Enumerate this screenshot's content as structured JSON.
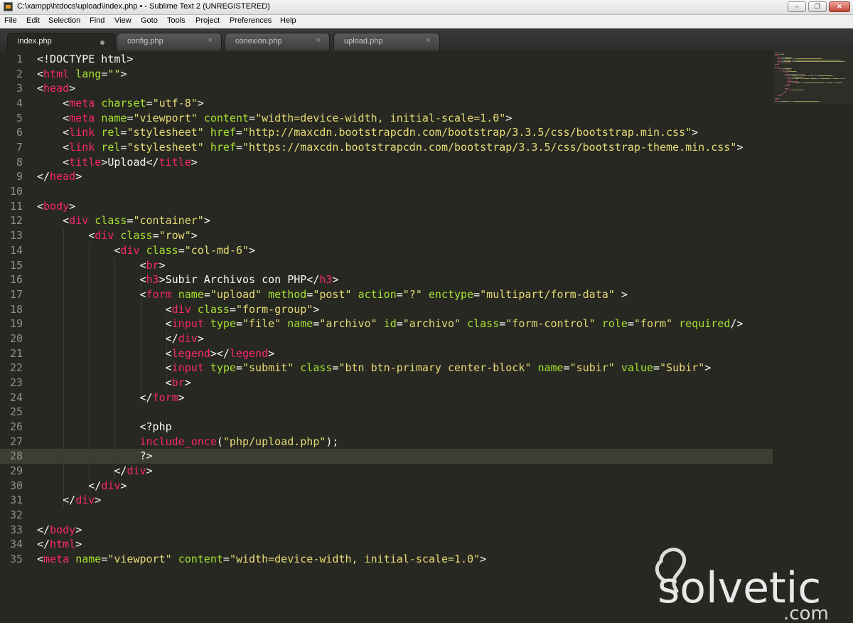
{
  "window": {
    "title": "C:\\xampp\\htdocs\\upload\\index.php • - Sublime Text 2 (UNREGISTERED)",
    "controls": {
      "minimize": "‒",
      "maximize": "❐",
      "close": "✕"
    }
  },
  "menu": [
    "File",
    "Edit",
    "Selection",
    "Find",
    "View",
    "Goto",
    "Tools",
    "Project",
    "Preferences",
    "Help"
  ],
  "tabs": [
    {
      "label": "index.php",
      "active": true,
      "dirty": true
    },
    {
      "label": "config.php",
      "active": false,
      "close": "×"
    },
    {
      "label": "conexion.php",
      "active": false,
      "close": "×"
    },
    {
      "label": "upload.php",
      "active": false,
      "close": "×"
    }
  ],
  "editor": {
    "current_line": 28,
    "theme_colors": {
      "background": "#272822",
      "tag": "#f92672",
      "attribute": "#a6e22e",
      "string": "#e6db74",
      "text": "#f8f8f2",
      "gutter": "#8f908a"
    },
    "lines": [
      [
        [
          "p",
          "<!DOCTYPE html>"
        ]
      ],
      [
        [
          "p",
          "<"
        ],
        [
          "t",
          "html"
        ],
        [
          "p",
          " "
        ],
        [
          "a",
          "lang"
        ],
        [
          "p",
          "="
        ],
        [
          "s",
          "\"\""
        ],
        [
          "p",
          ">"
        ]
      ],
      [
        [
          "p",
          "<"
        ],
        [
          "t",
          "head"
        ],
        [
          "p",
          ">"
        ]
      ],
      [
        [
          "p",
          "    <"
        ],
        [
          "t",
          "meta"
        ],
        [
          "p",
          " "
        ],
        [
          "a",
          "charset"
        ],
        [
          "p",
          "="
        ],
        [
          "s",
          "\"utf-8\""
        ],
        [
          "p",
          ">"
        ]
      ],
      [
        [
          "p",
          "    <"
        ],
        [
          "t",
          "meta"
        ],
        [
          "p",
          " "
        ],
        [
          "a",
          "name"
        ],
        [
          "p",
          "="
        ],
        [
          "s",
          "\"viewport\""
        ],
        [
          "p",
          " "
        ],
        [
          "a",
          "content"
        ],
        [
          "p",
          "="
        ],
        [
          "s",
          "\"width=device-width, initial-scale=1.0\""
        ],
        [
          "p",
          ">"
        ]
      ],
      [
        [
          "p",
          "    <"
        ],
        [
          "t",
          "link"
        ],
        [
          "p",
          " "
        ],
        [
          "a",
          "rel"
        ],
        [
          "p",
          "="
        ],
        [
          "s",
          "\"stylesheet\""
        ],
        [
          "p",
          " "
        ],
        [
          "a",
          "href"
        ],
        [
          "p",
          "="
        ],
        [
          "s",
          "\"http://maxcdn.bootstrapcdn.com/bootstrap/3.3.5/css/bootstrap.min.css\""
        ],
        [
          "p",
          ">"
        ]
      ],
      [
        [
          "p",
          "    <"
        ],
        [
          "t",
          "link"
        ],
        [
          "p",
          " "
        ],
        [
          "a",
          "rel"
        ],
        [
          "p",
          "="
        ],
        [
          "s",
          "\"stylesheet\""
        ],
        [
          "p",
          " "
        ],
        [
          "a",
          "href"
        ],
        [
          "p",
          "="
        ],
        [
          "s",
          "\"https://maxcdn.bootstrapcdn.com/bootstrap/3.3.5/css/bootstrap-theme.min.css\""
        ],
        [
          "p",
          ">"
        ]
      ],
      [
        [
          "p",
          "    <"
        ],
        [
          "t",
          "title"
        ],
        [
          "p",
          ">Upload</"
        ],
        [
          "t",
          "title"
        ],
        [
          "p",
          ">"
        ]
      ],
      [
        [
          "p",
          "</"
        ],
        [
          "t",
          "head"
        ],
        [
          "p",
          ">"
        ]
      ],
      [
        [
          "p",
          ""
        ]
      ],
      [
        [
          "p",
          "<"
        ],
        [
          "t",
          "body"
        ],
        [
          "p",
          ">"
        ]
      ],
      [
        [
          "p",
          "    <"
        ],
        [
          "t",
          "div"
        ],
        [
          "p",
          " "
        ],
        [
          "a",
          "class"
        ],
        [
          "p",
          "="
        ],
        [
          "s",
          "\"container\""
        ],
        [
          "p",
          ">"
        ]
      ],
      [
        [
          "p",
          "        <"
        ],
        [
          "t",
          "div"
        ],
        [
          "p",
          " "
        ],
        [
          "a",
          "class"
        ],
        [
          "p",
          "="
        ],
        [
          "s",
          "\"row\""
        ],
        [
          "p",
          ">"
        ]
      ],
      [
        [
          "p",
          "            <"
        ],
        [
          "t",
          "div"
        ],
        [
          "p",
          " "
        ],
        [
          "a",
          "class"
        ],
        [
          "p",
          "="
        ],
        [
          "s",
          "\"col-md-6\""
        ],
        [
          "p",
          ">"
        ]
      ],
      [
        [
          "p",
          "                <"
        ],
        [
          "t",
          "br"
        ],
        [
          "p",
          ">"
        ]
      ],
      [
        [
          "p",
          "                <"
        ],
        [
          "t",
          "h3"
        ],
        [
          "p",
          ">Subir Archivos con PHP</"
        ],
        [
          "t",
          "h3"
        ],
        [
          "p",
          ">"
        ]
      ],
      [
        [
          "p",
          "                <"
        ],
        [
          "t",
          "form"
        ],
        [
          "p",
          " "
        ],
        [
          "a",
          "name"
        ],
        [
          "p",
          "="
        ],
        [
          "s",
          "\"upload\""
        ],
        [
          "p",
          " "
        ],
        [
          "a",
          "method"
        ],
        [
          "p",
          "="
        ],
        [
          "s",
          "\"post\""
        ],
        [
          "p",
          " "
        ],
        [
          "a",
          "action"
        ],
        [
          "p",
          "="
        ],
        [
          "s",
          "\"?\""
        ],
        [
          "p",
          " "
        ],
        [
          "a",
          "enctype"
        ],
        [
          "p",
          "="
        ],
        [
          "s",
          "\"multipart/form-data\""
        ],
        [
          "p",
          " >"
        ]
      ],
      [
        [
          "p",
          "                    <"
        ],
        [
          "t",
          "div"
        ],
        [
          "p",
          " "
        ],
        [
          "a",
          "class"
        ],
        [
          "p",
          "="
        ],
        [
          "s",
          "\"form-group\""
        ],
        [
          "p",
          ">"
        ]
      ],
      [
        [
          "p",
          "                    <"
        ],
        [
          "t",
          "input"
        ],
        [
          "p",
          " "
        ],
        [
          "a",
          "type"
        ],
        [
          "p",
          "="
        ],
        [
          "s",
          "\"file\""
        ],
        [
          "p",
          " "
        ],
        [
          "a",
          "name"
        ],
        [
          "p",
          "="
        ],
        [
          "s",
          "\"archivo\""
        ],
        [
          "p",
          " "
        ],
        [
          "a",
          "id"
        ],
        [
          "p",
          "="
        ],
        [
          "s",
          "\"archivo\""
        ],
        [
          "p",
          " "
        ],
        [
          "a",
          "class"
        ],
        [
          "p",
          "="
        ],
        [
          "s",
          "\"form-control\""
        ],
        [
          "p",
          " "
        ],
        [
          "a",
          "role"
        ],
        [
          "p",
          "="
        ],
        [
          "s",
          "\"form\""
        ],
        [
          "p",
          " "
        ],
        [
          "a",
          "required"
        ],
        [
          "p",
          "/>"
        ]
      ],
      [
        [
          "p",
          "                    </"
        ],
        [
          "t",
          "div"
        ],
        [
          "p",
          ">"
        ]
      ],
      [
        [
          "p",
          "                    <"
        ],
        [
          "t",
          "legend"
        ],
        [
          "p",
          "></"
        ],
        [
          "t",
          "legend"
        ],
        [
          "p",
          ">"
        ]
      ],
      [
        [
          "p",
          "                    <"
        ],
        [
          "t",
          "input"
        ],
        [
          "p",
          " "
        ],
        [
          "a",
          "type"
        ],
        [
          "p",
          "="
        ],
        [
          "s",
          "\"submit\""
        ],
        [
          "p",
          " "
        ],
        [
          "a",
          "class"
        ],
        [
          "p",
          "="
        ],
        [
          "s",
          "\"btn btn-primary center-block\""
        ],
        [
          "p",
          " "
        ],
        [
          "a",
          "name"
        ],
        [
          "p",
          "="
        ],
        [
          "s",
          "\"subir\""
        ],
        [
          "p",
          " "
        ],
        [
          "a",
          "value"
        ],
        [
          "p",
          "="
        ],
        [
          "s",
          "\"Subir\""
        ],
        [
          "p",
          ">"
        ]
      ],
      [
        [
          "p",
          "                    <"
        ],
        [
          "t",
          "br"
        ],
        [
          "p",
          ">"
        ]
      ],
      [
        [
          "p",
          "                </"
        ],
        [
          "t",
          "form"
        ],
        [
          "p",
          ">"
        ]
      ],
      [
        [
          "p",
          ""
        ]
      ],
      [
        [
          "p",
          "                <?php"
        ]
      ],
      [
        [
          "p",
          "                "
        ],
        [
          "t",
          "include_once"
        ],
        [
          "p",
          "("
        ],
        [
          "s",
          "\"php/upload.php\""
        ],
        [
          "p",
          ");"
        ]
      ],
      [
        [
          "p",
          "                ?>"
        ]
      ],
      [
        [
          "p",
          "            </"
        ],
        [
          "t",
          "div"
        ],
        [
          "p",
          ">"
        ]
      ],
      [
        [
          "p",
          "        </"
        ],
        [
          "t",
          "div"
        ],
        [
          "p",
          ">"
        ]
      ],
      [
        [
          "p",
          "    </"
        ],
        [
          "t",
          "div"
        ],
        [
          "p",
          ">"
        ]
      ],
      [
        [
          "p",
          ""
        ]
      ],
      [
        [
          "p",
          "</"
        ],
        [
          "t",
          "body"
        ],
        [
          "p",
          ">"
        ]
      ],
      [
        [
          "p",
          "</"
        ],
        [
          "t",
          "html"
        ],
        [
          "p",
          ">"
        ]
      ],
      [
        [
          "p",
          "<"
        ],
        [
          "t",
          "meta"
        ],
        [
          "p",
          " "
        ],
        [
          "a",
          "name"
        ],
        [
          "p",
          "="
        ],
        [
          "s",
          "\"viewport\""
        ],
        [
          "p",
          " "
        ],
        [
          "a",
          "content"
        ],
        [
          "p",
          "="
        ],
        [
          "s",
          "\"width=device-width, initial-scale=1.0\""
        ],
        [
          "p",
          ">"
        ]
      ]
    ]
  },
  "watermark": {
    "brand": "solvetic",
    "suffix": ".com"
  }
}
